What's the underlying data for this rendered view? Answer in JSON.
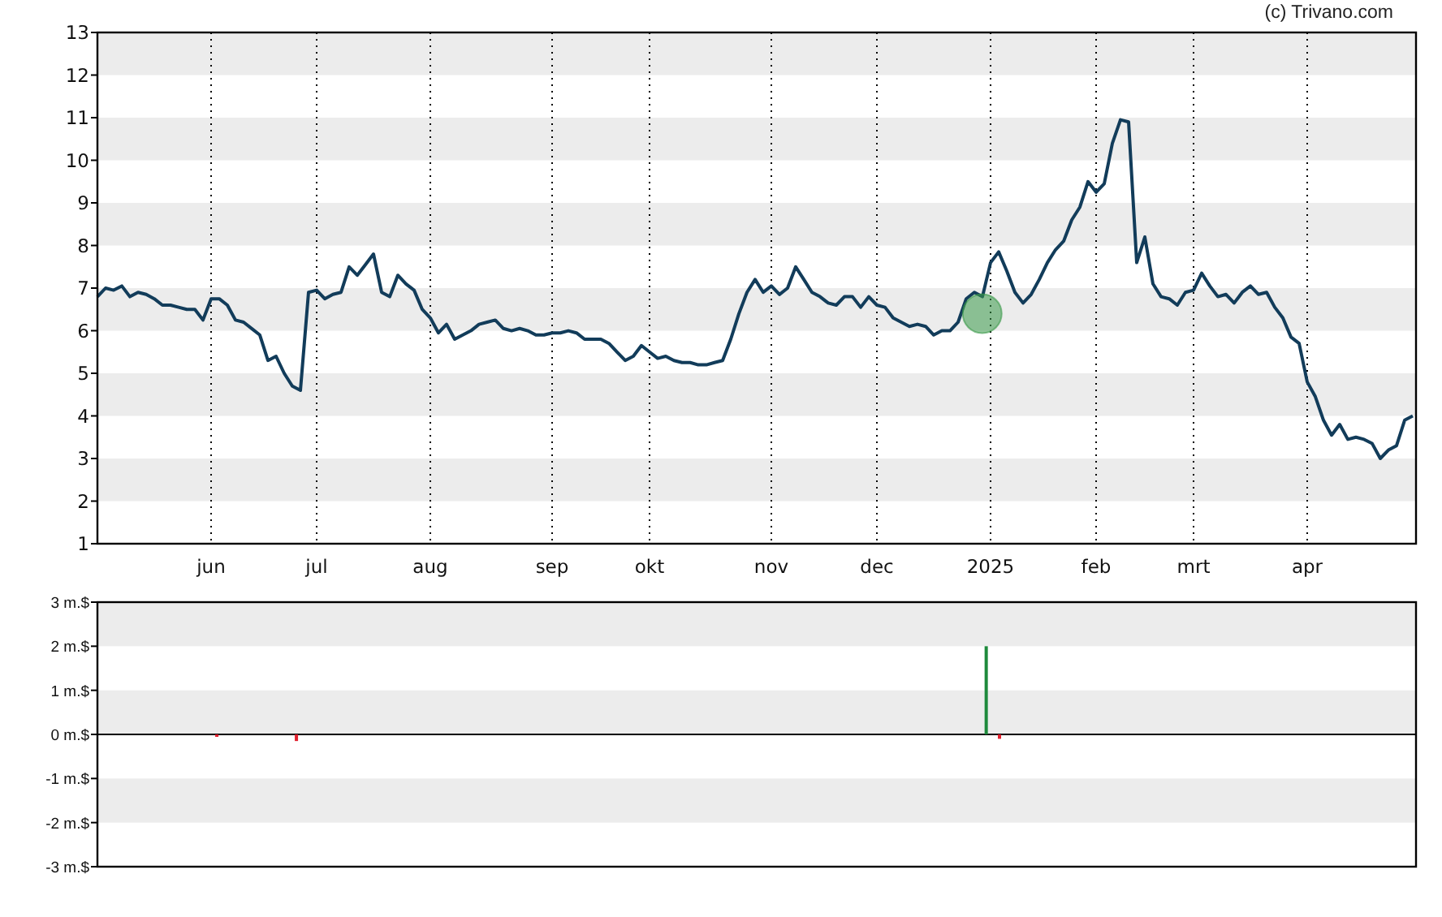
{
  "credit": "(c) Trivano.com",
  "price_chart": {
    "chart_data": {
      "type": "line",
      "ylim": [
        1,
        13
      ],
      "yticks": [
        1,
        2,
        3,
        4,
        5,
        6,
        7,
        8,
        9,
        10,
        11,
        12,
        13
      ],
      "categories": [
        null,
        null,
        null,
        null,
        null,
        null,
        null,
        null,
        null,
        null,
        null,
        null,
        null,
        null,
        "jun",
        null,
        null,
        null,
        null,
        null,
        null,
        null,
        null,
        null,
        null,
        null,
        null,
        "jul",
        null,
        null,
        null,
        null,
        null,
        null,
        null,
        null,
        null,
        null,
        null,
        null,
        null,
        "aug",
        null,
        null,
        null,
        null,
        null,
        null,
        null,
        null,
        null,
        null,
        null,
        null,
        null,
        null,
        "sep",
        null,
        null,
        null,
        null,
        null,
        null,
        null,
        null,
        null,
        null,
        null,
        "okt",
        null,
        null,
        null,
        null,
        null,
        null,
        null,
        null,
        null,
        null,
        null,
        null,
        null,
        null,
        "nov",
        null,
        null,
        null,
        null,
        null,
        null,
        null,
        null,
        null,
        null,
        null,
        null,
        "dec",
        null,
        null,
        null,
        null,
        null,
        null,
        null,
        null,
        null,
        null,
        null,
        null,
        null,
        "2025",
        null,
        null,
        null,
        null,
        null,
        null,
        null,
        null,
        null,
        null,
        null,
        null,
        "feb",
        null,
        null,
        null,
        null,
        null,
        null,
        null,
        null,
        null,
        null,
        null,
        "mrt",
        null,
        null,
        null,
        null,
        null,
        null,
        null,
        null,
        null,
        null,
        null,
        null,
        null,
        "apr",
        null,
        null,
        null,
        null,
        null,
        null,
        null,
        null,
        null,
        null,
        null,
        null,
        null
      ],
      "series": [
        {
          "color": "#123c5a",
          "values": [
            6.8,
            7.0,
            6.95,
            7.05,
            6.8,
            6.9,
            6.85,
            6.75,
            6.6,
            6.6,
            6.55,
            6.5,
            6.5,
            6.25,
            6.75,
            6.75,
            6.6,
            6.25,
            6.2,
            6.05,
            5.9,
            5.3,
            5.4,
            5.0,
            4.7,
            4.6,
            6.9,
            6.95,
            6.75,
            6.85,
            6.9,
            7.5,
            7.3,
            7.55,
            7.8,
            6.9,
            6.8,
            7.3,
            7.1,
            6.95,
            6.5,
            6.3,
            5.95,
            6.15,
            5.8,
            5.9,
            6.0,
            6.15,
            6.2,
            6.25,
            6.05,
            6.0,
            6.05,
            6.0,
            5.9,
            5.9,
            5.95,
            5.95,
            6.0,
            5.95,
            5.8,
            5.8,
            5.8,
            5.7,
            5.5,
            5.3,
            5.4,
            5.65,
            5.5,
            5.35,
            5.4,
            5.3,
            5.25,
            5.25,
            5.2,
            5.2,
            5.25,
            5.3,
            5.8,
            6.4,
            6.9,
            7.2,
            6.9,
            7.05,
            6.85,
            7.0,
            7.5,
            7.2,
            6.9,
            6.8,
            6.65,
            6.6,
            6.8,
            6.8,
            6.55,
            6.8,
            6.6,
            6.55,
            6.3,
            6.2,
            6.1,
            6.15,
            6.1,
            5.9,
            6.0,
            6.0,
            6.2,
            6.75,
            6.9,
            6.8,
            7.6,
            7.85,
            7.4,
            6.9,
            6.65,
            6.85,
            7.2,
            7.6,
            7.9,
            8.1,
            8.6,
            8.9,
            9.5,
            9.25,
            9.45,
            10.4,
            10.95,
            10.9,
            7.6,
            8.2,
            7.1,
            6.8,
            6.75,
            6.6,
            6.9,
            6.95,
            7.35,
            7.05,
            6.8,
            6.85,
            6.65,
            6.9,
            7.05,
            6.85,
            6.9,
            6.55,
            6.3,
            5.85,
            5.7,
            4.8,
            4.45,
            3.9,
            3.55,
            3.8,
            3.45,
            3.5,
            3.45,
            3.35,
            3.0,
            3.2,
            3.3,
            3.9,
            4.0
          ]
        }
      ]
    }
  },
  "transactions_chart": {
    "chart_data": {
      "type": "bar",
      "ylim": [
        -3,
        3
      ],
      "categories": [
        null,
        null,
        null,
        null,
        null,
        null,
        null,
        null,
        null,
        null,
        null,
        null,
        null,
        null,
        null,
        null,
        null,
        null,
        null,
        null,
        null,
        null,
        null,
        null,
        null,
        null,
        null,
        null,
        null,
        null,
        null,
        null,
        null,
        null,
        null,
        null,
        null,
        null,
        null,
        null,
        null,
        null,
        null,
        null,
        null,
        null,
        null,
        null,
        null,
        null,
        null,
        null,
        null,
        null,
        null,
        null,
        null,
        null,
        null,
        null,
        null,
        null,
        null,
        null,
        null,
        null,
        null,
        null,
        null,
        null,
        null,
        null,
        null,
        null,
        null,
        null,
        null,
        null,
        null,
        null,
        null,
        null,
        null,
        null,
        null,
        null,
        null,
        null,
        null,
        null,
        null,
        null,
        null,
        null,
        null,
        null,
        null,
        null,
        null,
        null
      ],
      "yticks": [
        {
          "value": 3,
          "label": "3 m.$"
        },
        {
          "value": 2,
          "label": "2 m.$"
        },
        {
          "value": 1,
          "label": "1 m.$"
        },
        {
          "value": 0,
          "label": "0 m.$"
        },
        {
          "value": -1,
          "label": "-1 m.$"
        },
        {
          "value": -2,
          "label": "-2 m.$"
        },
        {
          "value": -3,
          "label": "-3 m.$"
        }
      ],
      "series": [
        {
          "color": "#1e8a3c",
          "values": [
            null,
            null,
            null,
            null,
            null,
            null,
            null,
            null,
            null,
            null,
            null,
            null,
            null,
            null,
            null,
            null,
            null,
            null,
            null,
            null,
            null,
            null,
            null,
            null,
            null,
            null,
            null,
            null,
            null,
            null,
            null,
            null,
            null,
            null,
            null,
            null,
            null,
            null,
            null,
            null,
            null,
            null,
            null,
            null,
            null,
            null,
            null,
            null,
            null,
            null,
            null,
            null,
            null,
            null,
            null,
            null,
            null,
            null,
            null,
            null,
            null,
            null,
            null,
            null,
            null,
            null,
            null,
            2.0,
            null,
            null,
            null,
            null,
            null,
            null,
            null,
            null,
            null,
            null,
            null,
            null,
            null,
            null,
            null,
            null,
            null,
            null,
            null,
            null,
            null,
            null,
            null,
            null,
            null,
            null,
            null,
            null,
            null,
            null,
            null,
            null
          ]
        },
        {
          "color": "#e0202e",
          "values": [
            null,
            null,
            null,
            null,
            null,
            null,
            null,
            null,
            null,
            -0.05,
            null,
            null,
            null,
            null,
            null,
            -0.15,
            null,
            null,
            null,
            null,
            null,
            null,
            null,
            null,
            null,
            null,
            null,
            null,
            null,
            null,
            null,
            null,
            null,
            null,
            null,
            null,
            null,
            null,
            null,
            null,
            null,
            null,
            null,
            null,
            null,
            null,
            null,
            null,
            null,
            null,
            null,
            null,
            null,
            null,
            null,
            null,
            null,
            null,
            null,
            null,
            null,
            null,
            null,
            null,
            null,
            null,
            null,
            null,
            -0.1,
            null,
            null,
            null,
            null,
            null,
            null,
            null,
            null,
            null,
            null,
            null,
            null,
            null,
            null,
            null,
            null,
            null,
            null,
            null,
            null,
            null,
            null,
            null,
            null,
            null,
            null,
            null,
            null,
            null,
            null,
            null
          ]
        }
      ]
    }
  }
}
